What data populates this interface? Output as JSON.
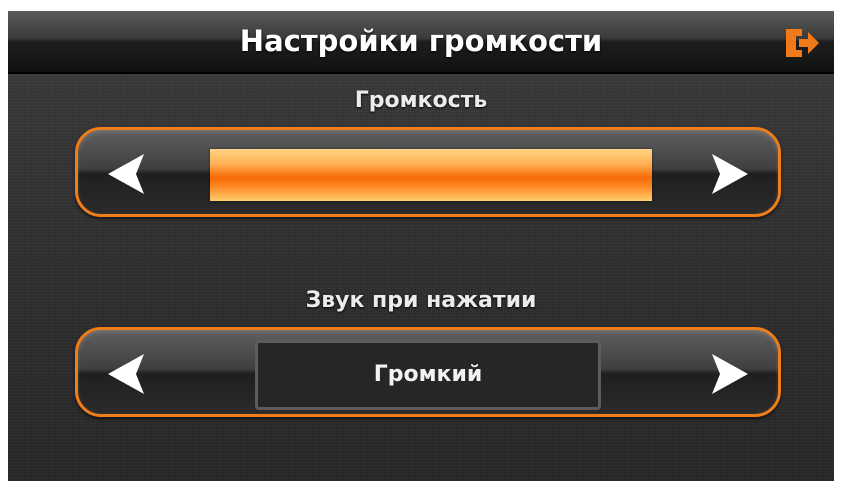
{
  "header": {
    "title": "Настройки громкости",
    "exit_icon": "exit-icon"
  },
  "volume": {
    "label": "Громкость",
    "level_percent": 100,
    "decrease_icon": "arrow-left-icon",
    "increase_icon": "arrow-right-icon"
  },
  "key_sound": {
    "label": "Звук при нажатии",
    "value": "Громкий",
    "prev_icon": "arrow-left-icon",
    "next_icon": "arrow-right-icon"
  },
  "colors": {
    "accent": "#ee7d1a",
    "bar": "#f66a06",
    "text": "#ffffff",
    "background": "#2e2e2e"
  }
}
